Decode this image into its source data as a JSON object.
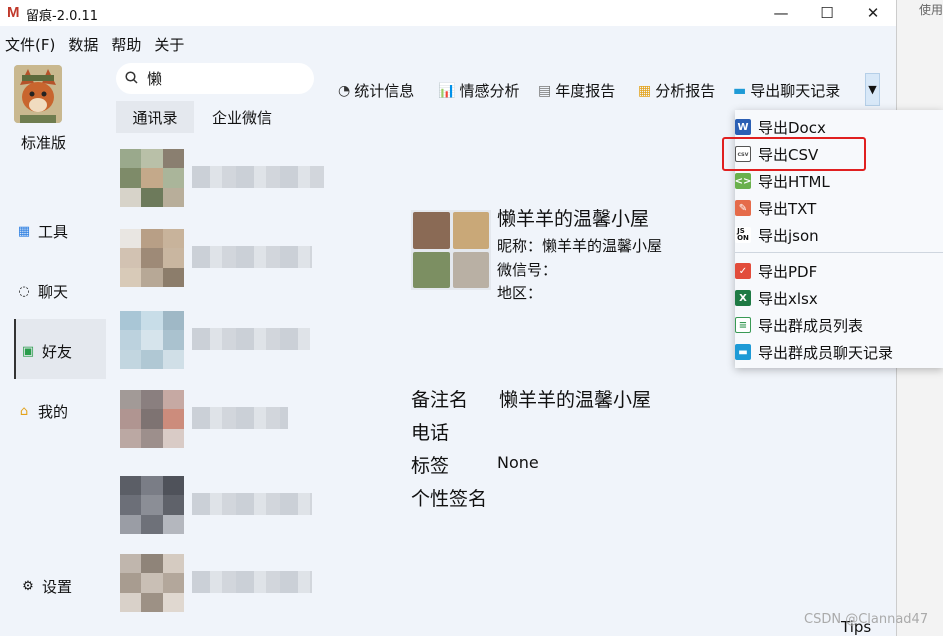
{
  "window": {
    "title": "留痕-2.0.11",
    "logo": "M",
    "minimize": "—",
    "maximize": "☐",
    "close": "✕"
  },
  "menu": [
    "文件(F)",
    "数据",
    "帮助",
    "关于"
  ],
  "right_strip": {
    "use_label": "使用"
  },
  "sidebar": {
    "edition": "标准版",
    "items": [
      {
        "label": "工具",
        "icon": "tool-icon"
      },
      {
        "label": "聊天",
        "icon": "chat-icon"
      },
      {
        "label": "好友",
        "icon": "friends-icon",
        "active": true
      },
      {
        "label": "我的",
        "icon": "my-icon"
      },
      {
        "label": "设置",
        "icon": "settings-icon"
      }
    ]
  },
  "search": {
    "value": "懒"
  },
  "tabs": [
    {
      "label": "通讯录",
      "active": true
    },
    {
      "label": "企业微信",
      "active": false
    }
  ],
  "toolbar": [
    "统计信息",
    "情感分析",
    "年度报告",
    "分析报告",
    "导出聊天记录"
  ],
  "profile": {
    "name": "懒羊羊的温馨小屋",
    "nickname_line": "昵称：懒羊羊的温馨小屋",
    "wechat_id_line": "微信号：",
    "region_line": "地区：",
    "details": {
      "remark_label": "备注名",
      "remark_value": "懒羊羊的温馨小屋",
      "phone_label": "电话",
      "tag_label": "标签",
      "tag_value": "None",
      "signature_label": "个性签名"
    }
  },
  "export_menu": {
    "items": [
      "导出Docx",
      "导出CSV",
      "导出HTML",
      "导出TXT",
      "导出json"
    ],
    "items2": [
      "导出PDF",
      "导出xlsx",
      "导出群成员列表",
      "导出群成员聊天记录"
    ],
    "highlighted": "导出CSV"
  },
  "footer": {
    "tips": "Tips",
    "watermark": "CSDN @Clannad47"
  }
}
